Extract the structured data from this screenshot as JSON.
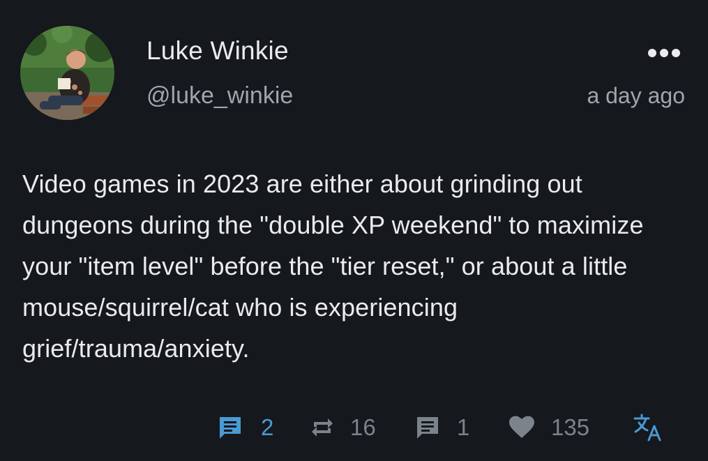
{
  "post": {
    "author": {
      "display_name": "Luke Winkie",
      "handle": "@luke_winkie",
      "avatar_icon": "avatar-photo"
    },
    "timestamp": "a day ago",
    "more_icon": "more-horizontal-icon",
    "text": "Video games in 2023 are either about grinding out dungeons during the \"double XP weekend\" to maximize your \"item level\" before the \"tier reset,\" or about a little mouse/squirrel/cat who is experiencing grief/trauma/anxiety.",
    "actions": {
      "replies": {
        "icon": "reply-icon",
        "count": "2",
        "color": "#4a9ad4"
      },
      "boosts": {
        "icon": "boost-icon",
        "count": "16",
        "color": "#7c838b"
      },
      "quotes": {
        "icon": "quote-icon",
        "count": "1",
        "color": "#7c838b"
      },
      "likes": {
        "icon": "heart-icon",
        "count": "135",
        "color": "#7c838b"
      },
      "translate": {
        "icon": "translate-icon",
        "color": "#4a9ad4"
      }
    }
  },
  "colors": {
    "background": "#15181c",
    "primary_text": "#e9ebee",
    "secondary_text": "#a0a6ad",
    "accent": "#4a9ad4"
  }
}
